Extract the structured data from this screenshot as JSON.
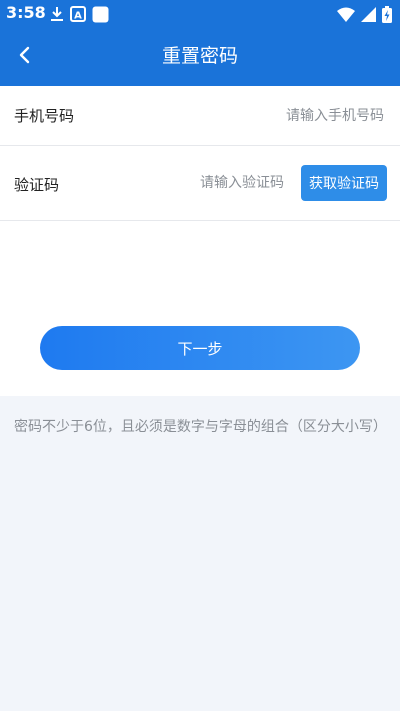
{
  "status_bar": {
    "time": "3:58",
    "icons": [
      "download-icon",
      "text-badge-icon",
      "notification-square-icon",
      "wifi-icon",
      "signal-icon",
      "battery-charging-icon"
    ],
    "badge_letter": "A"
  },
  "nav": {
    "title": "重置密码",
    "back_icon": "chevron-left-icon"
  },
  "form": {
    "phone_label": "手机号码",
    "phone_value": "",
    "phone_placeholder": "请输入手机号码",
    "code_label": "验证码",
    "code_value": "",
    "code_placeholder": "请输入验证码",
    "get_code_label": "获取验证码"
  },
  "next_label": "下一步",
  "hint": "密码不少于6位，且必须是数字与字母的组合（区分大小写）",
  "colors": {
    "header": "#1a73d9",
    "primary_button": "#2e8de8",
    "background": "#f2f5fa",
    "hint_text": "#8a8f96"
  }
}
